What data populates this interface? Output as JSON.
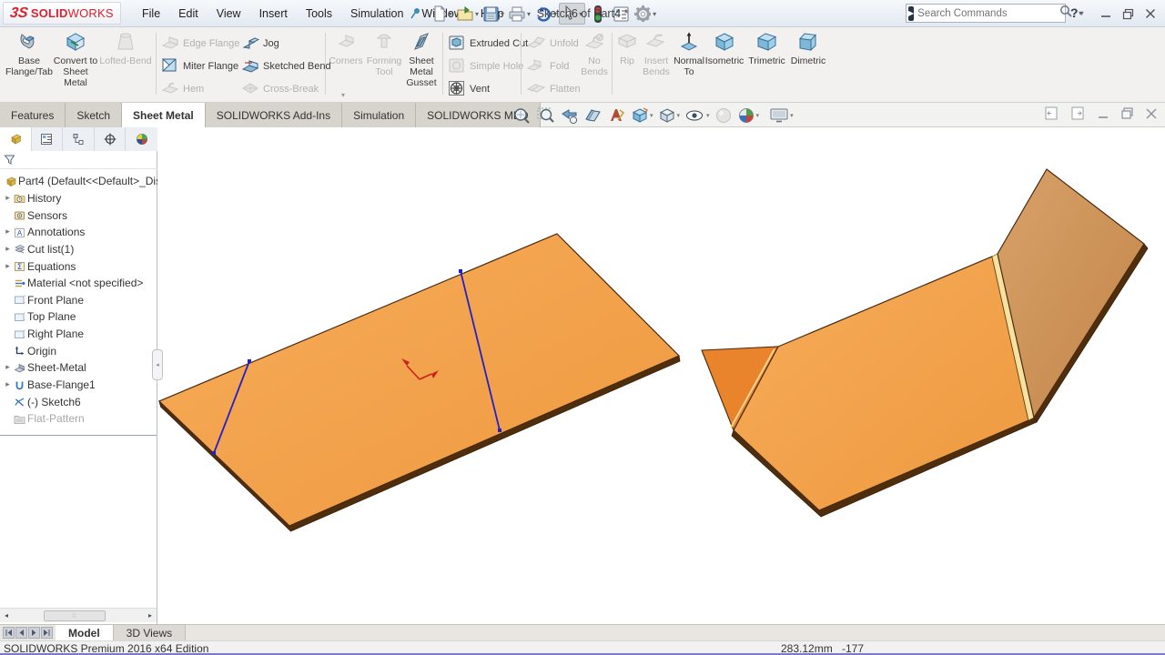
{
  "titlebar": {
    "logo_3s": "3S",
    "logo_solid": "SOLID",
    "logo_works": "WORKS",
    "menus": [
      "File",
      "Edit",
      "View",
      "Insert",
      "Tools",
      "Simulation",
      "Window",
      "Help"
    ],
    "doc_title": "Sketch6 of Part4 *",
    "search_placeholder": "Search Commands",
    "help_label": "?"
  },
  "ribbon": {
    "base_flange": "Base Flange/Tab",
    "convert": "Convert to Sheet Metal",
    "lofted_bend": "Lofted-Bend",
    "edge_flange": "Edge Flange",
    "miter_flange": "Miter Flange",
    "hem": "Hem",
    "jog": "Jog",
    "sketched_bend": "Sketched Bend",
    "cross_break": "Cross-Break",
    "corners": "Corners",
    "forming_tool": "Forming Tool",
    "gusset": "Sheet Metal Gusset",
    "extruded_cut": "Extruded Cut",
    "simple_hole": "Simple Hole",
    "vent": "Vent",
    "unfold": "Unfold",
    "fold": "Fold",
    "flatten": "Flatten",
    "no_bends": "No Bends",
    "rip": "Rip",
    "insert_bends": "Insert Bends",
    "normal_to": "Normal To",
    "isometric": "Isometric",
    "trimetric": "Trimetric",
    "dimetric": "Dimetric"
  },
  "command_tabs": [
    "Features",
    "Sketch",
    "Sheet Metal",
    "SOLIDWORKS Add-Ins",
    "Simulation",
    "SOLIDWORKS MBD"
  ],
  "active_tab": "Sheet Metal",
  "tree": {
    "root": "Part4  (Default<<Default>_Dis",
    "items": [
      {
        "label": "History",
        "arrow": true,
        "icon": "history-folder-icon",
        "disabled": false
      },
      {
        "label": "Sensors",
        "arrow": false,
        "icon": "sensors-icon",
        "disabled": false
      },
      {
        "label": "Annotations",
        "arrow": true,
        "icon": "annotations-icon",
        "disabled": false
      },
      {
        "label": "Cut list(1)",
        "arrow": true,
        "icon": "cut-list-icon",
        "disabled": false
      },
      {
        "label": "Equations",
        "arrow": true,
        "icon": "equations-icon",
        "disabled": false
      },
      {
        "label": "Material <not specified>",
        "arrow": false,
        "icon": "material-icon",
        "disabled": false
      },
      {
        "label": "Front Plane",
        "arrow": false,
        "icon": "plane-icon",
        "disabled": false
      },
      {
        "label": "Top Plane",
        "arrow": false,
        "icon": "plane-icon",
        "disabled": false
      },
      {
        "label": "Right Plane",
        "arrow": false,
        "icon": "plane-icon",
        "disabled": false
      },
      {
        "label": "Origin",
        "arrow": false,
        "icon": "origin-icon",
        "disabled": false
      },
      {
        "label": "Sheet-Metal",
        "arrow": true,
        "icon": "sheet-metal-icon",
        "disabled": false
      },
      {
        "label": "Base-Flange1",
        "arrow": true,
        "icon": "base-flange-icon",
        "disabled": false
      },
      {
        "label": "(-) Sketch6",
        "arrow": false,
        "icon": "sketch-icon",
        "disabled": false
      },
      {
        "label": "Flat-Pattern",
        "arrow": false,
        "icon": "flat-pattern-icon",
        "disabled": true
      }
    ]
  },
  "doc_tabs": {
    "model": "Model",
    "views": "3D Views"
  },
  "statusbar": {
    "edition": "SOLIDWORKS Premium 2016 x64 Edition",
    "dim": "283.12mm",
    "coord": "-177"
  },
  "viewport_colors": {
    "part_orange": "#f4a14d",
    "flap_orange": "#e9832c",
    "back_panel_tan": "#cf9a5e",
    "edge_brown": "#4f2e0d",
    "sketch_blue": "#2121c8",
    "origin_red": "#cc2020"
  }
}
